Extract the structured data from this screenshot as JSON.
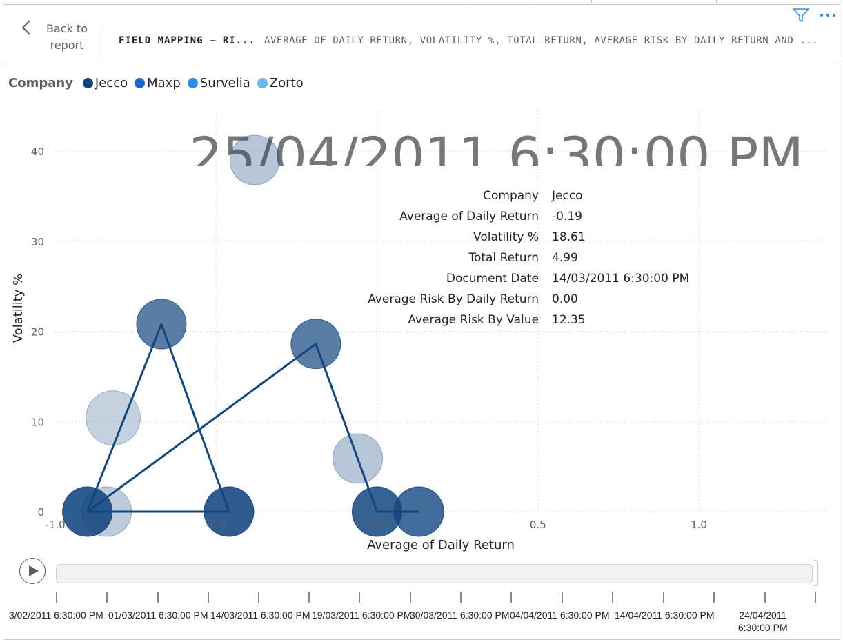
{
  "header": {
    "back_label": "Back to\nreport",
    "breadcrumb_page": "FIELD MAPPING – RI...",
    "breadcrumb_visual": "AVERAGE OF DAILY RETURN, VOLATILITY %, TOTAL RETURN, AVERAGE RISK BY DAILY RETURN AND ...",
    "filter_icon": "filter-icon",
    "more_icon": "more-options-icon"
  },
  "legend": {
    "title": "Company",
    "items": [
      {
        "label": "Jecco",
        "color": "#12467E"
      },
      {
        "label": "Maxp",
        "color": "#1A68C6"
      },
      {
        "label": "Survelia",
        "color": "#2C8EE8"
      },
      {
        "label": "Zorto",
        "color": "#6CB8F4"
      }
    ]
  },
  "play_axis": {
    "current": "25/04/2011 6:30:00 PM",
    "play_icon": "play-icon",
    "ticks": [
      "3/02/2011 6:30:00 PM",
      "01/03/2011 6:30:00 PM",
      "14/03/2011 6:30:00 PM",
      "19/03/2011 6:30:00 PM",
      "30/03/2011 6:30:00 PM",
      "04/04/2011 6:30:00 PM",
      "14/04/2011 6:30:00 PM",
      "24/04/2011\n6:30:00 PM"
    ]
  },
  "tooltip": {
    "rows": [
      {
        "label": "Company",
        "value": "Jecco"
      },
      {
        "label": "Average of Daily Return",
        "value": "-0.19"
      },
      {
        "label": "Volatility %",
        "value": "18.61"
      },
      {
        "label": "Total Return",
        "value": "4.99"
      },
      {
        "label": "Document Date",
        "value": "14/03/2011 6:30:00 PM"
      },
      {
        "label": "Average Risk By Daily Return",
        "value": "0.00"
      },
      {
        "label": "Average Risk By Value",
        "value": "12.35"
      }
    ]
  },
  "chart_data": {
    "type": "scatter",
    "xlabel": "Average of Daily Return",
    "ylabel": "Volatility %",
    "xlim": [
      -1.0,
      1.4
    ],
    "ylim": [
      -1,
      45
    ],
    "x_ticks": [
      -1.0,
      -0.5,
      0.0,
      0.5,
      1.0
    ],
    "x_tick_labels": [
      "-1.0",
      "-0.5",
      "0.0",
      "0.5",
      "1.0"
    ],
    "y_ticks": [
      0,
      10,
      20,
      30,
      40
    ],
    "y_tick_labels": [
      "0",
      "10",
      "20",
      "30",
      "40"
    ],
    "grid": true,
    "legend_position": "top-left",
    "size_field": "Total Return",
    "series": [
      {
        "name": "Jecco",
        "color": "#12467E",
        "trail": true,
        "points": [
          {
            "x": -0.84,
            "y": 0,
            "size": 5.0,
            "opacity": 0.28
          },
          {
            "x": -0.67,
            "y": 20.8,
            "size": 5.0,
            "opacity": 0.7
          },
          {
            "x": -0.38,
            "y": 39.0,
            "size": 5.0,
            "opacity": 0.3
          },
          {
            "x": -0.19,
            "y": 18.61,
            "size": 4.99,
            "opacity": 0.7
          },
          {
            "x": -0.06,
            "y": 5.9,
            "size": 5.0,
            "opacity": 0.3
          },
          {
            "x": -0.82,
            "y": 10.4,
            "size": 6.0,
            "opacity": 0.25
          },
          {
            "x": -0.9,
            "y": 0,
            "size": 5.0,
            "opacity": 0.88
          },
          {
            "x": -0.46,
            "y": 0,
            "size": 5.0,
            "opacity": 0.88
          },
          {
            "x": 0.0,
            "y": 0,
            "size": 5.0,
            "opacity": 0.85
          },
          {
            "x": 0.13,
            "y": 0,
            "size": 5.0,
            "opacity": 0.8
          }
        ],
        "trail_points": [
          {
            "x": -0.9,
            "y": 0
          },
          {
            "x": -0.67,
            "y": 20.8
          },
          {
            "x": -0.46,
            "y": 0
          },
          {
            "x": -0.9,
            "y": 0
          },
          {
            "x": -0.19,
            "y": 18.61
          },
          {
            "x": 0.0,
            "y": 0
          },
          {
            "x": 0.13,
            "y": 0
          }
        ]
      }
    ]
  }
}
